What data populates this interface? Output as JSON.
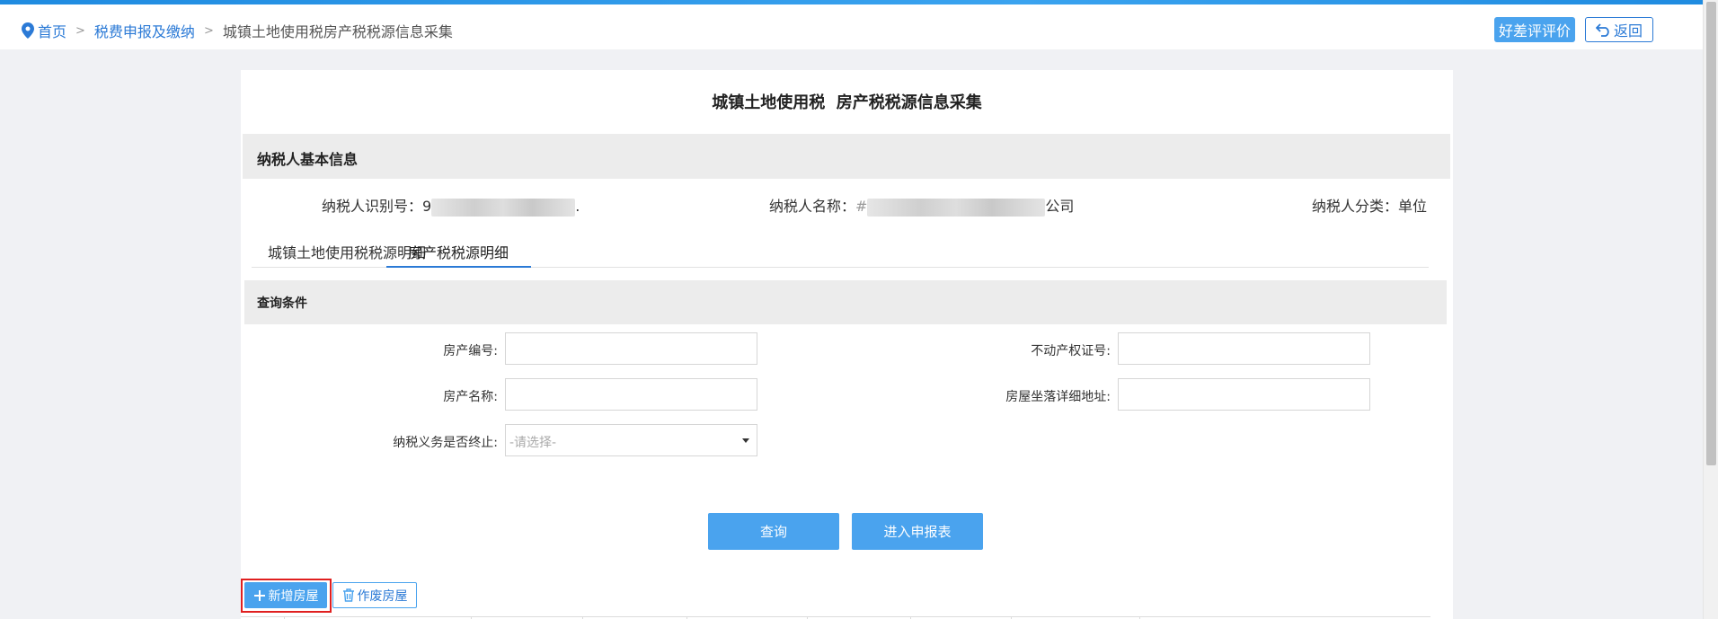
{
  "breadcrumb": {
    "home": "首页",
    "level2": "税费申报及缴纳",
    "current": "城镇土地使用税房产税税源信息采集",
    "separator": ">"
  },
  "header_buttons": {
    "rate": "好差评评价",
    "back": "返回"
  },
  "page": {
    "title": "城镇土地使用税  房产税税源信息采集"
  },
  "taxpayer_section": {
    "title": "纳税人基本信息",
    "id_label": "纳税人识别号：",
    "id_value_prefix": "9",
    "id_value_suffix": ".",
    "name_label": "纳税人名称：",
    "name_value_prefix": "",
    "name_value_suffix": "公司",
    "category_label": "纳税人分类：",
    "category_value": "单位"
  },
  "tabs": [
    {
      "label": "城镇土地使用税税源明细",
      "active": false
    },
    {
      "label": "房产税税源明细",
      "active": true
    }
  ],
  "query": {
    "title": "查询条件",
    "fields": {
      "property_no_label": "房产编号:",
      "cert_no_label": "不动产权证号:",
      "property_name_label": "房产名称:",
      "address_label": "房屋坐落详细地址:",
      "terminated_label": "纳税义务是否终止:",
      "terminated_placeholder": "-请选择-"
    },
    "buttons": {
      "search": "查询",
      "enter_report": "进入申报表"
    }
  },
  "actions": {
    "add": "新增房屋",
    "void": "作废房屋"
  },
  "colors": {
    "accent": "#2b7ad6",
    "button": "#4aa3ee",
    "highlight": "#e02020"
  }
}
